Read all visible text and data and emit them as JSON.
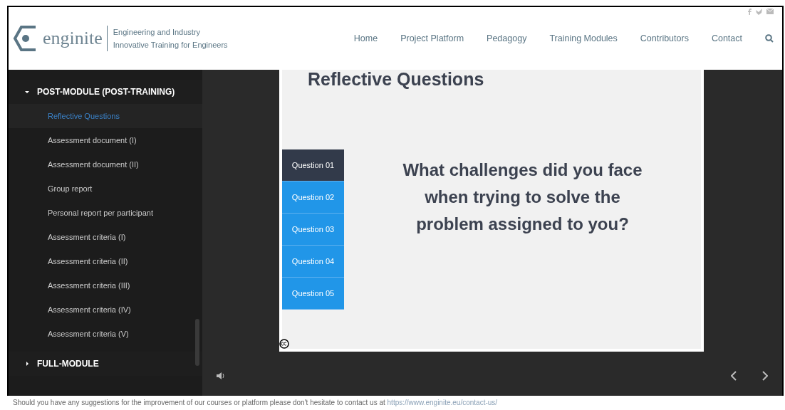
{
  "header": {
    "logo": "enginite",
    "tagline_1": "Engineering and Industry",
    "tagline_2": "Innovative Training for Engineers",
    "nav": [
      {
        "label": "Home",
        "selected": false
      },
      {
        "label": "Project Platform",
        "selected": false
      },
      {
        "label": "Pedagogy",
        "selected": false
      },
      {
        "label": "Training Modules",
        "selected": false
      },
      {
        "label": "Contributors",
        "selected": false
      },
      {
        "label": "Contact",
        "selected": false
      }
    ]
  },
  "sidebar": {
    "sections": [
      {
        "title": "POST-MODULE (POST-TRAINING)",
        "expanded": true,
        "items": [
          {
            "label": "Reflective Questions",
            "selected": true
          },
          {
            "label": "Assessment document (I)",
            "selected": false
          },
          {
            "label": "Assessment document (II)",
            "selected": false
          },
          {
            "label": "Group report",
            "selected": false
          },
          {
            "label": "Personal report per participant",
            "selected": false
          },
          {
            "label": "Assessment criteria (I)",
            "selected": false
          },
          {
            "label": "Assessment criteria (II)",
            "selected": false
          },
          {
            "label": "Assessment criteria (III)",
            "selected": false
          },
          {
            "label": "Assessment criteria (IV)",
            "selected": false
          },
          {
            "label": "Assessment criteria (V)",
            "selected": false
          }
        ]
      },
      {
        "title": "FULL-MODULE",
        "expanded": false
      }
    ]
  },
  "slide": {
    "title": "Reflective Questions",
    "tabs": [
      {
        "label": "Question 01",
        "selected": true
      },
      {
        "label": "Question 02",
        "selected": false
      },
      {
        "label": "Question 03",
        "selected": false
      },
      {
        "label": "Question 04",
        "selected": false
      },
      {
        "label": "Question  05",
        "selected": false
      }
    ],
    "question": "What challenges did you face when trying to solve the problem assigned to you?"
  },
  "footer": {
    "text": "Should you have any suggestions for the improvement of our courses or platform please don't hesitate to contact us at",
    "link": "https://www.enginite.eu/contact-us/"
  }
}
